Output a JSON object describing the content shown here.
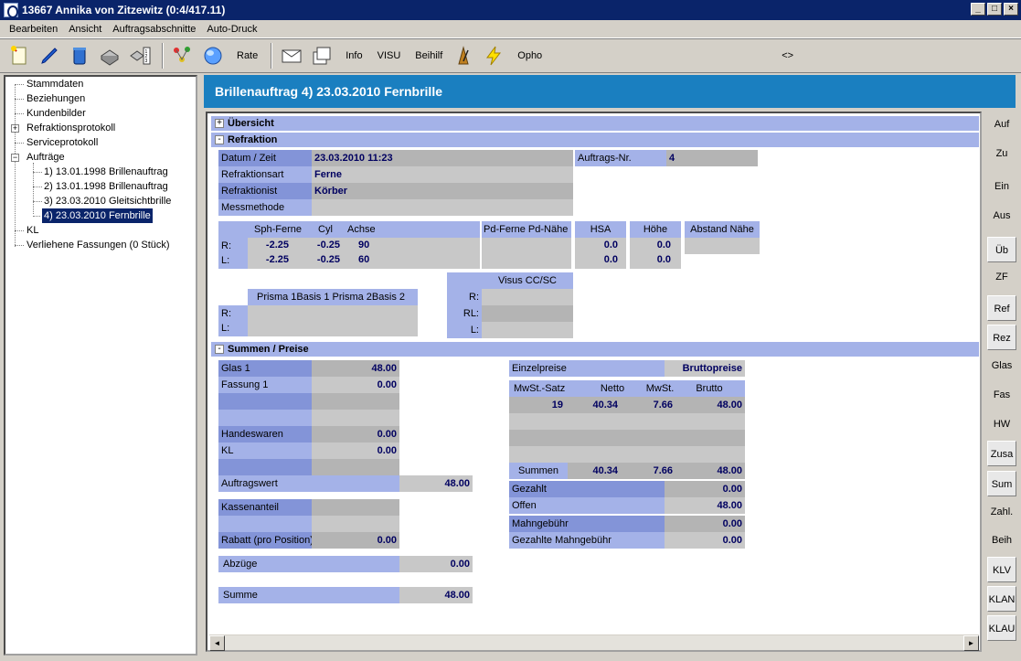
{
  "window": {
    "title": "13667  Annika von Zitzewitz   (0:4/417.11)"
  },
  "menu": [
    "Bearbeiten",
    "Ansicht",
    "Auftragsabschnitte",
    "Auto-Druck"
  ],
  "toolbar": {
    "rate": "Rate",
    "info": "Info",
    "visu": "VISU",
    "beihilf": "Beihilf",
    "opho": "Opho",
    "nav": "<>"
  },
  "tree": {
    "stammdaten": "Stammdaten",
    "beziehungen": "Beziehungen",
    "kundenbilder": "Kundenbilder",
    "refraktionsprotokoll": "Refraktionsprotokoll",
    "serviceprotokoll": "Serviceprotokoll",
    "auftraege": "Aufträge",
    "orders": [
      "1)  13.01.1998 Brillenauftrag",
      "2)  13.01.1998 Brillenauftrag",
      "3)  23.03.2010 Gleitsichtbrille",
      "4)  23.03.2010 Fernbrille"
    ],
    "kl": "KL",
    "verliehene": "Verliehene Fassungen (0 Stück)"
  },
  "header": {
    "title": "Brillenauftrag   4)  23.03.2010 Fernbrille"
  },
  "sections": {
    "uebersicht": "Übersicht",
    "refraktion": "Refraktion",
    "summen": "Summen / Preise"
  },
  "refraktion": {
    "datum_label": "Datum / Zeit",
    "datum": "23.03.2010 11:23",
    "art_label": "Refraktionsart",
    "art": "Ferne",
    "ist_label": "Refraktionist",
    "ist": "Körber",
    "mess_label": "Messmethode",
    "auftragsnr_label": "Auftrags-Nr.",
    "auftragsnr": "4",
    "sph_head": "Sph-Ferne",
    "cyl_head": "Cyl",
    "achse_head": "Achse",
    "pd_head": "Pd-Ferne Pd-Nähe",
    "hsa_head": "HSA",
    "hoehe_head": "Höhe",
    "abstand_head": "Abstand Nähe",
    "r": "R:",
    "l": "L:",
    "rl": "RL:",
    "r_sph": "-2.25",
    "r_cyl": "-0.25",
    "r_achse": "90",
    "l_sph": "-2.25",
    "l_cyl": "-0.25",
    "l_achse": "60",
    "r_hsa": "0.0",
    "l_hsa": "0.0",
    "r_hoehe": "0.0",
    "l_hoehe": "0.0",
    "prisma_head": "Prisma 1Basis 1     Prisma 2Basis 2",
    "visus_head": "Visus CC/SC"
  },
  "summen": {
    "glas_label": "Glas 1",
    "glas": "48.00",
    "fassung_label": "Fassung 1",
    "fassung": "0.00",
    "handel_label": "Handeswaren",
    "handel": "0.00",
    "kl_label": "KL",
    "kl": "0.00",
    "auftragswert_label": "Auftragswert",
    "auftragswert": "48.00",
    "kasse_label": "Kassenanteil",
    "rabatt_label": "Rabatt (pro Position)",
    "rabatt": "0.00",
    "abzuege_label": "Abzüge",
    "abzuege": "0.00",
    "summe_label": "Summe",
    "summe": "48.00",
    "einzel_label": "Einzelpreise",
    "brutto_label": "Bruttopreise",
    "mwst_satz_head": "MwSt.-Satz",
    "netto_head": "Netto",
    "mwst_head": "MwSt.",
    "brutto_head": "Brutto",
    "row_satz": "19",
    "row_netto": "40.34",
    "row_mwst": "7.66",
    "row_brutto": "48.00",
    "sum_label": "Summen",
    "sum_netto": "40.34",
    "sum_mwst": "7.66",
    "sum_brutto": "48.00",
    "gezahlt_label": "Gezahlt",
    "gezahlt": "0.00",
    "offen_label": "Offen",
    "offen": "48.00",
    "mahn_label": "Mahngebühr",
    "mahn": "0.00",
    "gezmahn_label": "Gezahlte Mahngebühr",
    "gezmahn": "0.00"
  },
  "sidebar": [
    "Auf",
    "Zu",
    "Ein",
    "Aus",
    "Üb",
    "ZF",
    "Ref",
    "Rez",
    "Glas",
    "Fas",
    "HW",
    "Zusa",
    "Sum",
    "Zahl.",
    "Beih",
    "KLV",
    "KLAN",
    "KLAU"
  ]
}
